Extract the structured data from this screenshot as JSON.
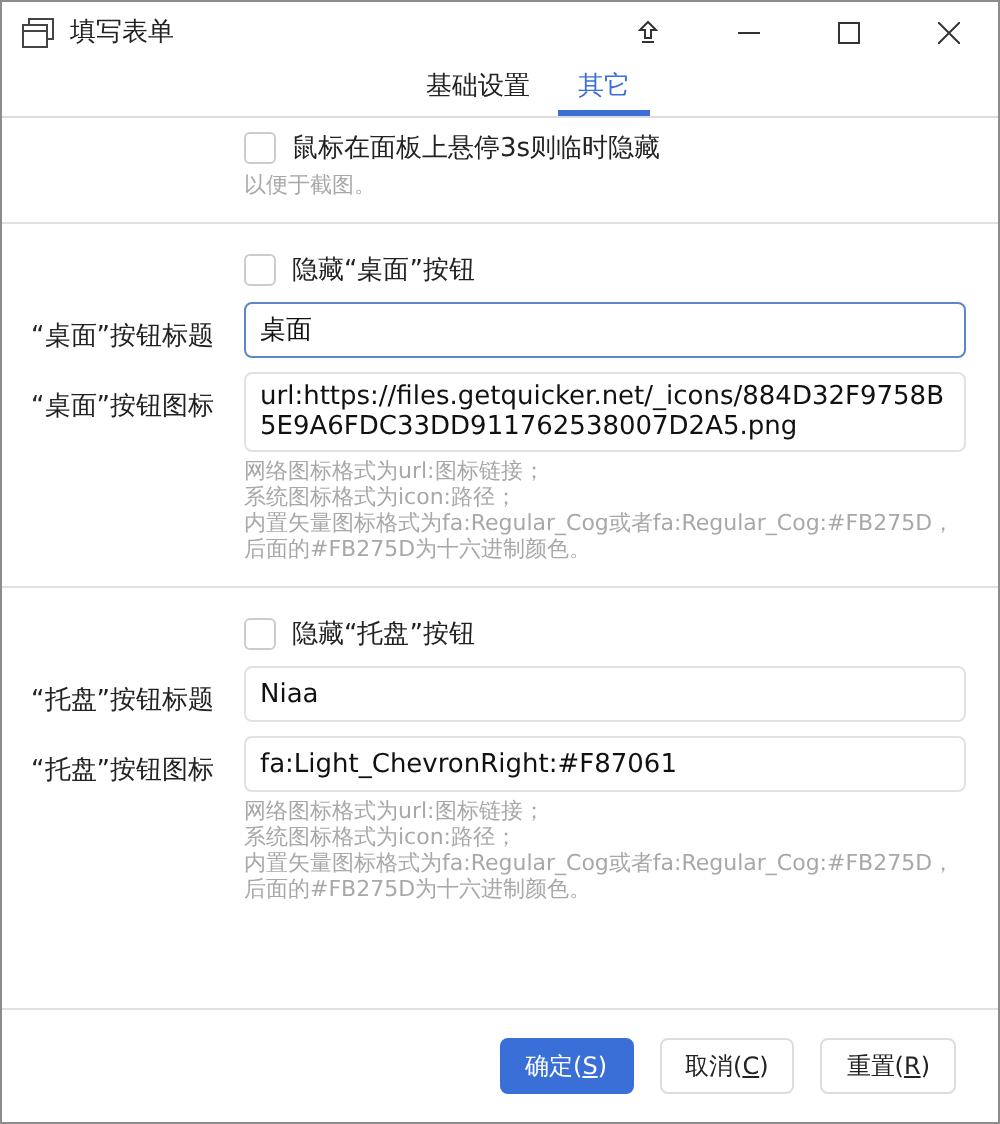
{
  "window": {
    "title": "填写表单"
  },
  "tabs": [
    {
      "label": "基础设置",
      "selected": false
    },
    {
      "label": "其它",
      "selected": true
    }
  ],
  "sections": [
    {
      "rows": [
        {
          "kind": "checkbox",
          "label": "鼠标在面板上悬停3s则临时隐藏",
          "checked": false,
          "hint": [
            "以便于截图。"
          ]
        }
      ]
    },
    {
      "rows": [
        {
          "kind": "checkbox",
          "label": "隐藏“桌面”按钮",
          "checked": false
        },
        {
          "kind": "field",
          "label": "“桌面”按钮标题",
          "value": "桌面",
          "focused": true
        },
        {
          "kind": "field",
          "label": "“桌面”按钮图标",
          "value": "url:https://files.getquicker.net/_icons/884D32F9758B5E9A6FDC33DD911762538007D2A5.png",
          "focused": false,
          "hint": [
            "网络图标格式为url:图标链接；",
            "系统图标格式为icon:路径；",
            "内置矢量图标格式为fa:Regular_Cog或者fa:Regular_Cog:#FB275D，",
            "后面的#FB275D为十六进制颜色。"
          ]
        }
      ]
    },
    {
      "rows": [
        {
          "kind": "checkbox",
          "label": "隐藏“托盘”按钮",
          "checked": false
        },
        {
          "kind": "field",
          "label": "“托盘”按钮标题",
          "value": "Niaa",
          "focused": false
        },
        {
          "kind": "field",
          "label": "“托盘”按钮图标",
          "value": "fa:Light_ChevronRight:#F87061",
          "focused": false,
          "hint": [
            "网络图标格式为url:图标链接；",
            "系统图标格式为icon:路径；",
            "内置矢量图标格式为fa:Regular_Cog或者fa:Regular_Cog:#FB275D，",
            "后面的#FB275D为十六进制颜色。"
          ]
        }
      ]
    }
  ],
  "buttons": [
    {
      "prefix": "确定(",
      "hotkey": "S",
      "suffix": ")",
      "primary": true
    },
    {
      "prefix": "取消(",
      "hotkey": "C",
      "suffix": ")",
      "primary": false
    },
    {
      "prefix": "重置(",
      "hotkey": "R",
      "suffix": ")",
      "primary": false
    }
  ]
}
